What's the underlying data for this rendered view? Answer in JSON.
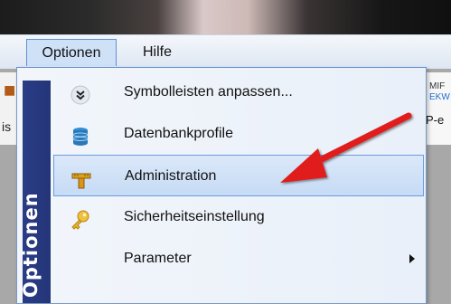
{
  "menubar": {
    "items": [
      {
        "label": "Optionen"
      },
      {
        "label": "Hilfe"
      }
    ]
  },
  "background": {
    "left_text": "is",
    "right_line1": "MIF",
    "right_line2": "EKW",
    "right_line3": "P-e"
  },
  "dropdown": {
    "side_label": "Optionen",
    "items": [
      {
        "label": "Symbolleisten anpassen...",
        "icon": "chevrons-down-icon",
        "selected": false,
        "submenu": false
      },
      {
        "label": "Datenbankprofile",
        "icon": "database-icon",
        "selected": false,
        "submenu": false
      },
      {
        "label": "Administration",
        "icon": "tool-icon",
        "selected": true,
        "submenu": false
      },
      {
        "label": "Sicherheitseinstellung",
        "icon": "key-icon",
        "selected": false,
        "submenu": false
      },
      {
        "label": "Parameter",
        "icon": "",
        "selected": false,
        "submenu": true
      }
    ]
  },
  "colors": {
    "accent": "#5f8fd4",
    "side_band": "#2a3c85",
    "annotation": "#e01b1b"
  }
}
